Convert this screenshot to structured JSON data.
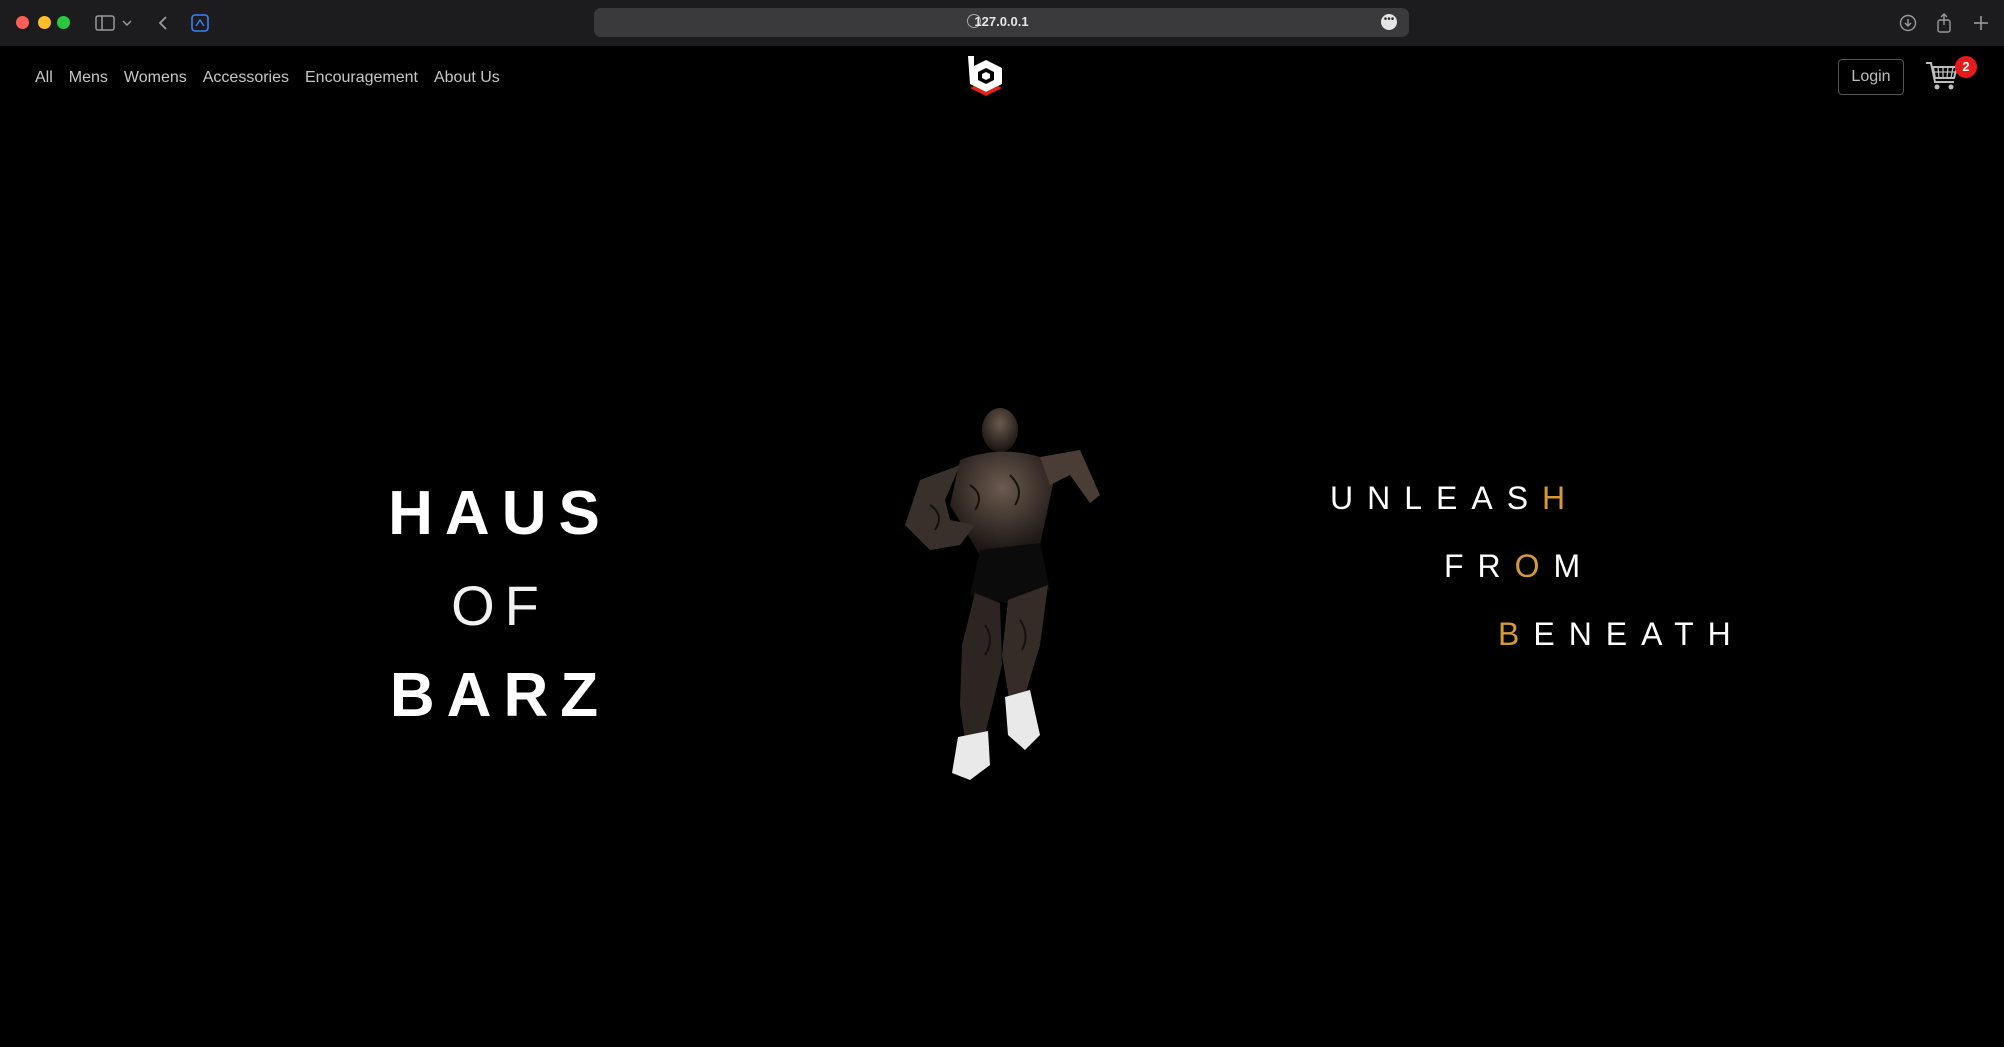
{
  "browser": {
    "url": "127.0.0.1"
  },
  "nav": {
    "links": [
      "All",
      "Mens",
      "Womens",
      "Accessories",
      "Encouragement",
      "About Us"
    ]
  },
  "header": {
    "login_label": "Login",
    "cart_count": "2"
  },
  "hero": {
    "title_line1": "HAUS",
    "title_line2": "OF",
    "title_line3": "BARZ",
    "tagline": [
      {
        "pre": "UNLEAS",
        "accent": "H",
        "post": ""
      },
      {
        "pre": "FR",
        "accent": "O",
        "post": "M"
      },
      {
        "pre": "",
        "accent": "B",
        "post": "ENEATH"
      }
    ]
  },
  "colors": {
    "background": "#000000",
    "accent": "#d49a3a",
    "badge": "#e51b1b"
  },
  "icons": [
    "sidebar-icon",
    "chevron-down-icon",
    "back-icon",
    "tab-icon",
    "globe-icon",
    "more-icon",
    "download-icon",
    "share-icon",
    "plus-icon",
    "logo-icon",
    "cart-icon"
  ]
}
